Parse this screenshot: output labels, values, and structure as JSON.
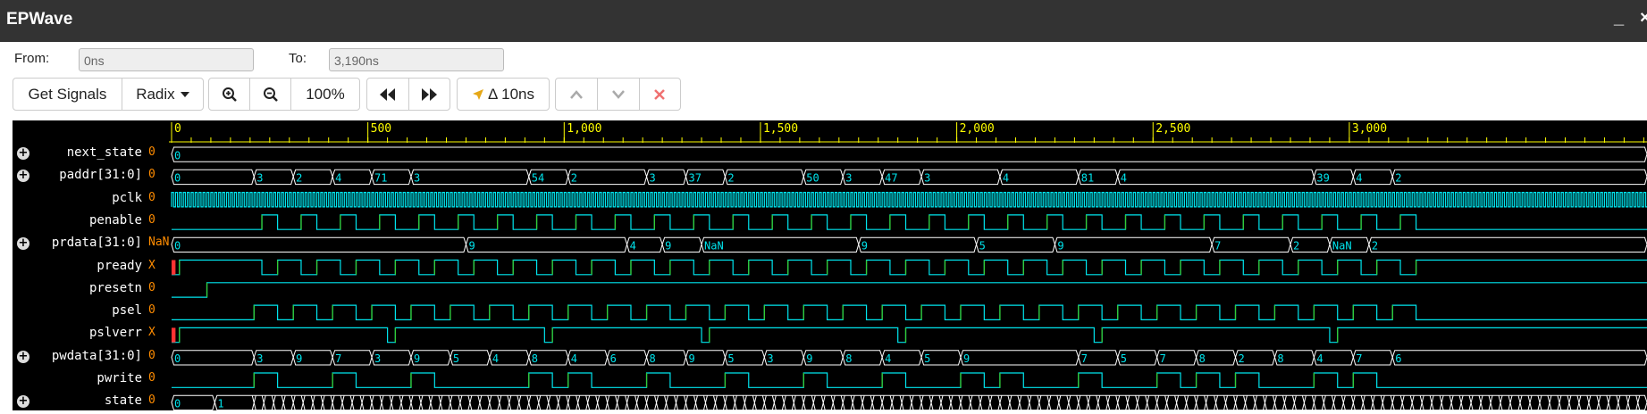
{
  "window": {
    "title": "EPWave",
    "minimize_label": "_",
    "close_label": "×"
  },
  "range": {
    "from_label": "From:",
    "from_value": "0ns",
    "to_label": "To:",
    "to_value": "3,190ns"
  },
  "toolbar": {
    "get_signals_label": "Get Signals",
    "radix_label": "Radix",
    "zoom_in_icon": "magnifier-plus-icon",
    "zoom_out_icon": "magnifier-minus-icon",
    "zoom_level": "100%",
    "prev_edge_icon": "double-left-arrow-icon",
    "next_edge_icon": "double-right-arrow-icon",
    "cursor_icon": "cursor-arrow-icon",
    "delta_label": "Δ 10ns",
    "move_up_icon": "chevron-up-icon",
    "move_down_icon": "chevron-down-icon",
    "remove_icon": "close-icon"
  },
  "colors": {
    "background": "#000000",
    "ruler": "#ffff00",
    "digital": "#00e5ee",
    "digital_low": "#1ea2ff",
    "green": "#33cc33",
    "bus": "#ffffff",
    "bus_text": "#00e5ee",
    "value": "#ff8c00",
    "unknown": "#ff3333"
  },
  "timeline": {
    "ticks": [
      {
        "t": 0,
        "label": "0"
      },
      {
        "t": 500,
        "label": "500"
      },
      {
        "t": 1000,
        "label": "1,000"
      },
      {
        "t": 1500,
        "label": "1,500"
      },
      {
        "t": 2000,
        "label": "2,000"
      },
      {
        "t": 2500,
        "label": "2,500"
      },
      {
        "t": 3000,
        "label": "3,000"
      }
    ],
    "minor_step": 50
  },
  "signals": [
    {
      "name": "next_state",
      "value": "0",
      "expandable": true,
      "kind": "bus",
      "segments": [
        {
          "t": 0,
          "v": "0"
        }
      ]
    },
    {
      "name": "paddr[31:0]",
      "value": "0",
      "expandable": true,
      "kind": "bus",
      "segments": [
        {
          "t": 0,
          "v": "0"
        },
        {
          "t": 210,
          "v": "3"
        },
        {
          "t": 310,
          "v": "2"
        },
        {
          "t": 410,
          "v": "4"
        },
        {
          "t": 510,
          "v": "71"
        },
        {
          "t": 610,
          "v": "3"
        },
        {
          "t": 910,
          "v": "54"
        },
        {
          "t": 1010,
          "v": "2"
        },
        {
          "t": 1210,
          "v": "3"
        },
        {
          "t": 1310,
          "v": "37"
        },
        {
          "t": 1410,
          "v": "2"
        },
        {
          "t": 1610,
          "v": "50"
        },
        {
          "t": 1710,
          "v": "3"
        },
        {
          "t": 1810,
          "v": "47"
        },
        {
          "t": 1910,
          "v": "3"
        },
        {
          "t": 2110,
          "v": "4"
        },
        {
          "t": 2310,
          "v": "81"
        },
        {
          "t": 2410,
          "v": "4"
        },
        {
          "t": 2910,
          "v": "39"
        },
        {
          "t": 3010,
          "v": "4"
        },
        {
          "t": 3110,
          "v": "2"
        }
      ]
    },
    {
      "name": "pclk",
      "value": "0",
      "expandable": false,
      "kind": "clock",
      "period": 10
    },
    {
      "name": "penable",
      "value": "0",
      "expandable": false,
      "kind": "bit",
      "edges": [
        0,
        230,
        270,
        330,
        370,
        430,
        470,
        530,
        570,
        630,
        670,
        730,
        770,
        830,
        870,
        930,
        970,
        1030,
        1070,
        1130,
        1170,
        1230,
        1270,
        1330,
        1370,
        1430,
        1470,
        1530,
        1570,
        1630,
        1670,
        1730,
        1770,
        1830,
        1870,
        1930,
        1970,
        2030,
        2070,
        2130,
        2170,
        2230,
        2270,
        2330,
        2370,
        2430,
        2470,
        2530,
        2570,
        2630,
        2670,
        2730,
        2770,
        2830,
        2870,
        2930,
        2970,
        3030,
        3070,
        3130,
        3170
      ],
      "initial": 0
    },
    {
      "name": "prdata[31:0]",
      "value": "NaN",
      "expandable": true,
      "kind": "bus",
      "segments": [
        {
          "t": 0,
          "v": "0"
        },
        {
          "t": 750,
          "v": "9"
        },
        {
          "t": 1160,
          "v": "4"
        },
        {
          "t": 1250,
          "v": "9"
        },
        {
          "t": 1350,
          "v": "NaN"
        },
        {
          "t": 1750,
          "v": "9"
        },
        {
          "t": 2050,
          "v": "5"
        },
        {
          "t": 2250,
          "v": "9"
        },
        {
          "t": 2650,
          "v": "7"
        },
        {
          "t": 2850,
          "v": "2"
        },
        {
          "t": 2950,
          "v": "NaN"
        },
        {
          "t": 3050,
          "v": "2"
        }
      ]
    },
    {
      "name": "pready",
      "value": "X",
      "expandable": false,
      "kind": "bit",
      "edges": [
        0,
        20,
        230,
        270,
        330,
        370,
        430,
        470,
        530,
        570,
        630,
        670,
        730,
        770,
        830,
        870,
        930,
        970,
        1030,
        1070,
        1130,
        1170,
        1230,
        1270,
        1330,
        1370,
        1430,
        1470,
        1530,
        1570,
        1630,
        1670,
        1730,
        1770,
        1830,
        1870,
        1930,
        1970,
        2030,
        2070,
        2130,
        2170,
        2230,
        2270,
        2330,
        2370,
        2430,
        2470,
        2530,
        2570,
        2630,
        2670,
        2730,
        2770,
        2830,
        2870,
        2930,
        2970,
        3030,
        3070,
        3130,
        3170
      ],
      "initial": 0,
      "unknown_until": 10
    },
    {
      "name": "presetn",
      "value": "0",
      "expandable": false,
      "kind": "bit",
      "edges": [
        0,
        90
      ],
      "initial": 0
    },
    {
      "name": "psel",
      "value": "0",
      "expandable": false,
      "kind": "bit",
      "edges": [
        0,
        210,
        270,
        310,
        370,
        410,
        470,
        510,
        570,
        610,
        670,
        710,
        770,
        810,
        870,
        910,
        970,
        1010,
        1070,
        1110,
        1170,
        1210,
        1270,
        1310,
        1370,
        1410,
        1470,
        1510,
        1570,
        1610,
        1670,
        1710,
        1770,
        1810,
        1870,
        1910,
        1970,
        2010,
        2070,
        2110,
        2170,
        2210,
        2270,
        2310,
        2370,
        2410,
        2470,
        2510,
        2570,
        2610,
        2670,
        2710,
        2770,
        2810,
        2870,
        2910,
        2970,
        3010,
        3070,
        3110,
        3170
      ],
      "initial": 0
    },
    {
      "name": "pslverr",
      "value": "X",
      "expandable": false,
      "kind": "bit",
      "edges": [
        0,
        20,
        550,
        570,
        950,
        970,
        1350,
        1370,
        1850,
        1870,
        2350,
        2370,
        2950,
        2970
      ],
      "initial": 0,
      "unknown_until": 10
    },
    {
      "name": "pwdata[31:0]",
      "value": "0",
      "expandable": true,
      "kind": "bus",
      "segments": [
        {
          "t": 0,
          "v": "0"
        },
        {
          "t": 210,
          "v": "3"
        },
        {
          "t": 310,
          "v": "9"
        },
        {
          "t": 410,
          "v": "7"
        },
        {
          "t": 510,
          "v": "3"
        },
        {
          "t": 610,
          "v": "9"
        },
        {
          "t": 710,
          "v": "5"
        },
        {
          "t": 810,
          "v": "4"
        },
        {
          "t": 910,
          "v": "8"
        },
        {
          "t": 1010,
          "v": "4"
        },
        {
          "t": 1110,
          "v": "6"
        },
        {
          "t": 1210,
          "v": "8"
        },
        {
          "t": 1310,
          "v": "9"
        },
        {
          "t": 1410,
          "v": "5"
        },
        {
          "t": 1510,
          "v": "3"
        },
        {
          "t": 1610,
          "v": "9"
        },
        {
          "t": 1710,
          "v": "8"
        },
        {
          "t": 1810,
          "v": "4"
        },
        {
          "t": 1910,
          "v": "5"
        },
        {
          "t": 2010,
          "v": "9"
        },
        {
          "t": 2310,
          "v": "7"
        },
        {
          "t": 2410,
          "v": "5"
        },
        {
          "t": 2510,
          "v": "7"
        },
        {
          "t": 2610,
          "v": "8"
        },
        {
          "t": 2710,
          "v": "2"
        },
        {
          "t": 2810,
          "v": "8"
        },
        {
          "t": 2910,
          "v": "4"
        },
        {
          "t": 3010,
          "v": "7"
        },
        {
          "t": 3110,
          "v": "6"
        }
      ]
    },
    {
      "name": "pwrite",
      "value": "0",
      "expandable": false,
      "kind": "bit",
      "edges": [
        0,
        210,
        270,
        410,
        470,
        610,
        670,
        910,
        970,
        1010,
        1070,
        1210,
        1270,
        1410,
        1470,
        1610,
        1670,
        1810,
        1870,
        2010,
        2070,
        2110,
        2170,
        2310,
        2370,
        2510,
        2570,
        2610,
        2670,
        2710,
        2770,
        2910,
        2970,
        3010,
        3070
      ],
      "initial": 0
    },
    {
      "name": "state",
      "value": "0",
      "expandable": true,
      "kind": "bus",
      "segments": [
        {
          "t": 0,
          "v": "0"
        },
        {
          "t": 110,
          "v": "1"
        }
      ]
    }
  ]
}
